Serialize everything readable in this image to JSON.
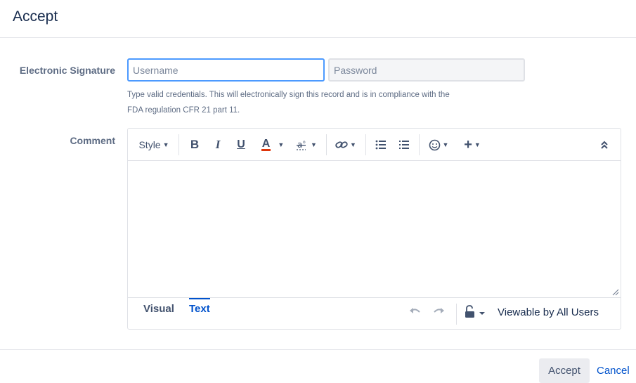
{
  "dialog": {
    "title": "Accept"
  },
  "signature": {
    "label": "Electronic Signature",
    "username_placeholder": "Username",
    "password_placeholder": "Password",
    "help_line1": "Type valid credentials. This will electronically sign this record and is in compliance with the",
    "help_line2": "FDA regulation CFR 21 part 11."
  },
  "comment": {
    "label": "Comment",
    "toolbar": {
      "style_label": "Style",
      "items": [
        "bold-icon",
        "italic-icon",
        "underline-icon",
        "text-color-icon",
        "formatting-icon",
        "link-icon",
        "bullet-list-icon",
        "numbered-list-icon",
        "emoji-icon",
        "insert-icon",
        "collapse-icon"
      ],
      "bold": "B",
      "italic": "I",
      "underline": "U",
      "text_color": "A",
      "text_color_hex": "#de350b",
      "insert": "+"
    },
    "tabs": {
      "visual": "Visual",
      "text": "Text",
      "active": "Text"
    },
    "restriction": "Viewable by All Users"
  },
  "buttons": {
    "accept": "Accept",
    "cancel": "Cancel"
  },
  "colors": {
    "accent": "#0052cc",
    "focus_border": "#4c9aff"
  }
}
